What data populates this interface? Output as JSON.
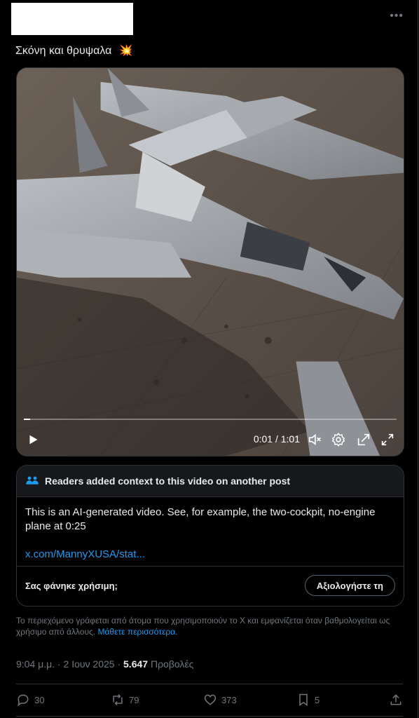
{
  "post": {
    "text": "Σκόνη και θρυψαλα",
    "emoji": "💥"
  },
  "video": {
    "progress": 0.016,
    "time_label": "0:01 / 1:01"
  },
  "community_note": {
    "header": "Readers added context to this video on another post",
    "body": "This is an AI-generated video. See, for example, the two-cockpit, no-engine plane at 0:25",
    "link_text": "x.com/MannyXUSA/stat...",
    "question": "Σας φάνηκε χρήσιμη;",
    "rate_button": "Αξιολογήστε τη"
  },
  "disclaimer": {
    "text": "Το περιεχόμενο γράφεται από άτομα που χρησιμοποιούν το X και εμφανίζεται όταν βαθμολογείται ως χρήσιμο από άλλους.",
    "learn_more": "Μάθετε περισσότερα."
  },
  "meta": {
    "time": "9:04 μ.μ.",
    "separator": "·",
    "date": "2 Ιουν 2025",
    "views_count": "5.647",
    "views_label": "Προβολές"
  },
  "actions": {
    "replies": "30",
    "reposts": "79",
    "likes": "373",
    "bookmarks": "5"
  },
  "icons": [
    "more-icon",
    "play-icon",
    "mute-icon",
    "settings-icon",
    "popout-icon",
    "fullscreen-icon",
    "people-icon",
    "reply-icon",
    "repost-icon",
    "like-icon",
    "bookmark-icon",
    "share-icon"
  ],
  "colors": {
    "accent": "#1d9bf0",
    "muted": "#71767b",
    "border": "#2f3336"
  }
}
